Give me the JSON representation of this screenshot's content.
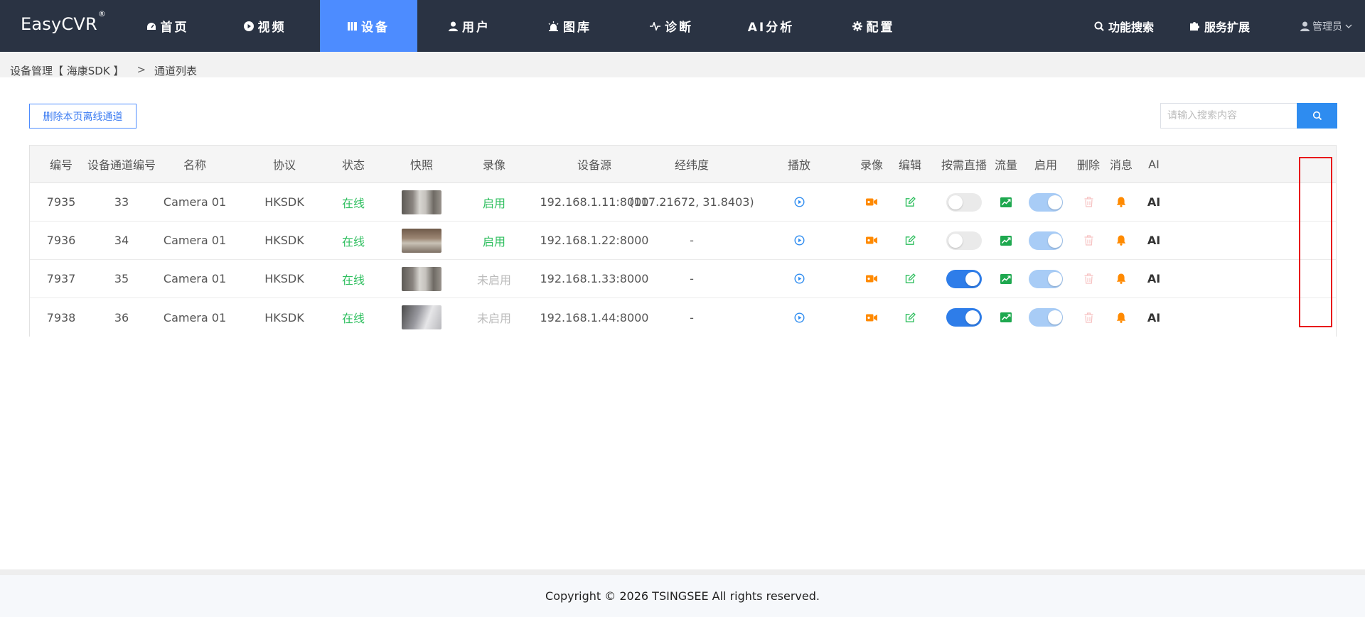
{
  "app": {
    "logo": "EasyCVR",
    "logo_mark": "®"
  },
  "nav": {
    "items": [
      {
        "label": "首页",
        "icon": "dashboard-icon"
      },
      {
        "label": "视频",
        "icon": "play-circle-icon"
      },
      {
        "label": "设备",
        "icon": "device-icon",
        "active": true
      },
      {
        "label": "用户",
        "icon": "user-icon"
      },
      {
        "label": "图库",
        "icon": "alarm-light-icon"
      },
      {
        "label": "诊断",
        "icon": "pulse-icon"
      },
      {
        "label": "AI分析",
        "icon": ""
      },
      {
        "label": "配置",
        "icon": "gear-icon"
      }
    ],
    "search_label": "功能搜索",
    "extensions_label": "服务扩展",
    "user_label": "管理员"
  },
  "breadcrumb": {
    "parent": "设备管理【 海康SDK 】",
    "separator": ">",
    "current": "通道列表"
  },
  "toolbar": {
    "delete_offline_label": "删除本页离线通道",
    "search_placeholder": "请输入搜索内容"
  },
  "table": {
    "columns": [
      "编号",
      "设备通道编号",
      "名称",
      "协议",
      "状态",
      "快照",
      "录像",
      "设备源",
      "经纬度",
      "播放",
      "录像",
      "编辑",
      "按需直播",
      "流量",
      "启用",
      "删除",
      "消息",
      "AI"
    ],
    "rows": [
      {
        "id": "7935",
        "channel": "33",
        "name": "Camera 01",
        "protocol": "HKSDK",
        "status": "在线",
        "record": "启用",
        "record_on": true,
        "source": "192.168.1.11:8000",
        "coords": "(117.21672, 31.8403)",
        "on_demand": false,
        "enabled": true,
        "ai": "AI"
      },
      {
        "id": "7936",
        "channel": "34",
        "name": "Camera 01",
        "protocol": "HKSDK",
        "status": "在线",
        "record": "启用",
        "record_on": true,
        "source": "192.168.1.22:8000",
        "coords": "-",
        "on_demand": false,
        "enabled": true,
        "ai": "AI"
      },
      {
        "id": "7937",
        "channel": "35",
        "name": "Camera 01",
        "protocol": "HKSDK",
        "status": "在线",
        "record": "未启用",
        "record_on": false,
        "source": "192.168.1.33:8000",
        "coords": "-",
        "on_demand": true,
        "enabled": true,
        "ai": "AI"
      },
      {
        "id": "7938",
        "channel": "36",
        "name": "Camera 01",
        "protocol": "HKSDK",
        "status": "在线",
        "record": "未启用",
        "record_on": false,
        "source": "192.168.1.44:8000",
        "coords": "-",
        "on_demand": true,
        "enabled": true,
        "ai": "AI"
      }
    ]
  },
  "colors": {
    "nav_bg": "#2a3343",
    "accent": "#4d8cff",
    "online": "#2fbf5f",
    "highlight": "#e8141b"
  },
  "footer": {
    "copyright": "Copyright © 2026 TSINGSEE All rights reserved."
  }
}
